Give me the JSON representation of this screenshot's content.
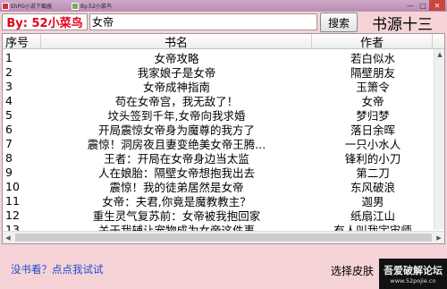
{
  "window": {
    "app_title": "EhPG小说下载器",
    "second_tab": "By:52小菜鸟",
    "buttons": [
      "—",
      "□",
      "✕"
    ]
  },
  "toolbar": {
    "brand": "By: 52小菜鸟",
    "search_value": "女帝",
    "search_label": "搜索",
    "source_label": "书源十三"
  },
  "table": {
    "headers": [
      "序号",
      "书名",
      "作者"
    ],
    "rows": [
      {
        "no": "1",
        "title": "女帝攻略",
        "author": "若白似水"
      },
      {
        "no": "2",
        "title": "我家娘子是女帝",
        "author": "隔壁朋友"
      },
      {
        "no": "3",
        "title": "女帝成神指南",
        "author": "玉箫令"
      },
      {
        "no": "4",
        "title": "苟在女帝宫，我无敌了！",
        "author": "女帝"
      },
      {
        "no": "5",
        "title": "坟头签到千年,女帝向我求婚",
        "author": "梦归梦"
      },
      {
        "no": "6",
        "title": "开局震惊女帝身为魔尊的我方了",
        "author": "落日余晖"
      },
      {
        "no": "7",
        "title": "震惊！洞房夜且妻变绝美女帝王腾...",
        "author": "一只小水人"
      },
      {
        "no": "8",
        "title": "王者：开局在女帝身边当太监",
        "author": "锋利的小刀"
      },
      {
        "no": "9",
        "title": "人在娘胎：隔壁女帝想抱我出去",
        "author": "第二刀"
      },
      {
        "no": "10",
        "title": "震惊！我的徒弟居然是女帝",
        "author": "东风破浪"
      },
      {
        "no": "11",
        "title": "女帝：夫君,你竟是魔教教主？",
        "author": "迦男"
      },
      {
        "no": "12",
        "title": "重生灵气复苏前：女帝被我抱回家",
        "author": "纸扇江山"
      },
      {
        "no": "13",
        "title": "关于我辅让宠物成为女帝这件事",
        "author": "有人叫我宇宙师"
      }
    ]
  },
  "footer": {
    "link": "没书看？点点我试试",
    "skin_button": "选择皮肤",
    "watermark_main": "吾爱破解论坛",
    "watermark_url": "www.52pojie.cn"
  }
}
